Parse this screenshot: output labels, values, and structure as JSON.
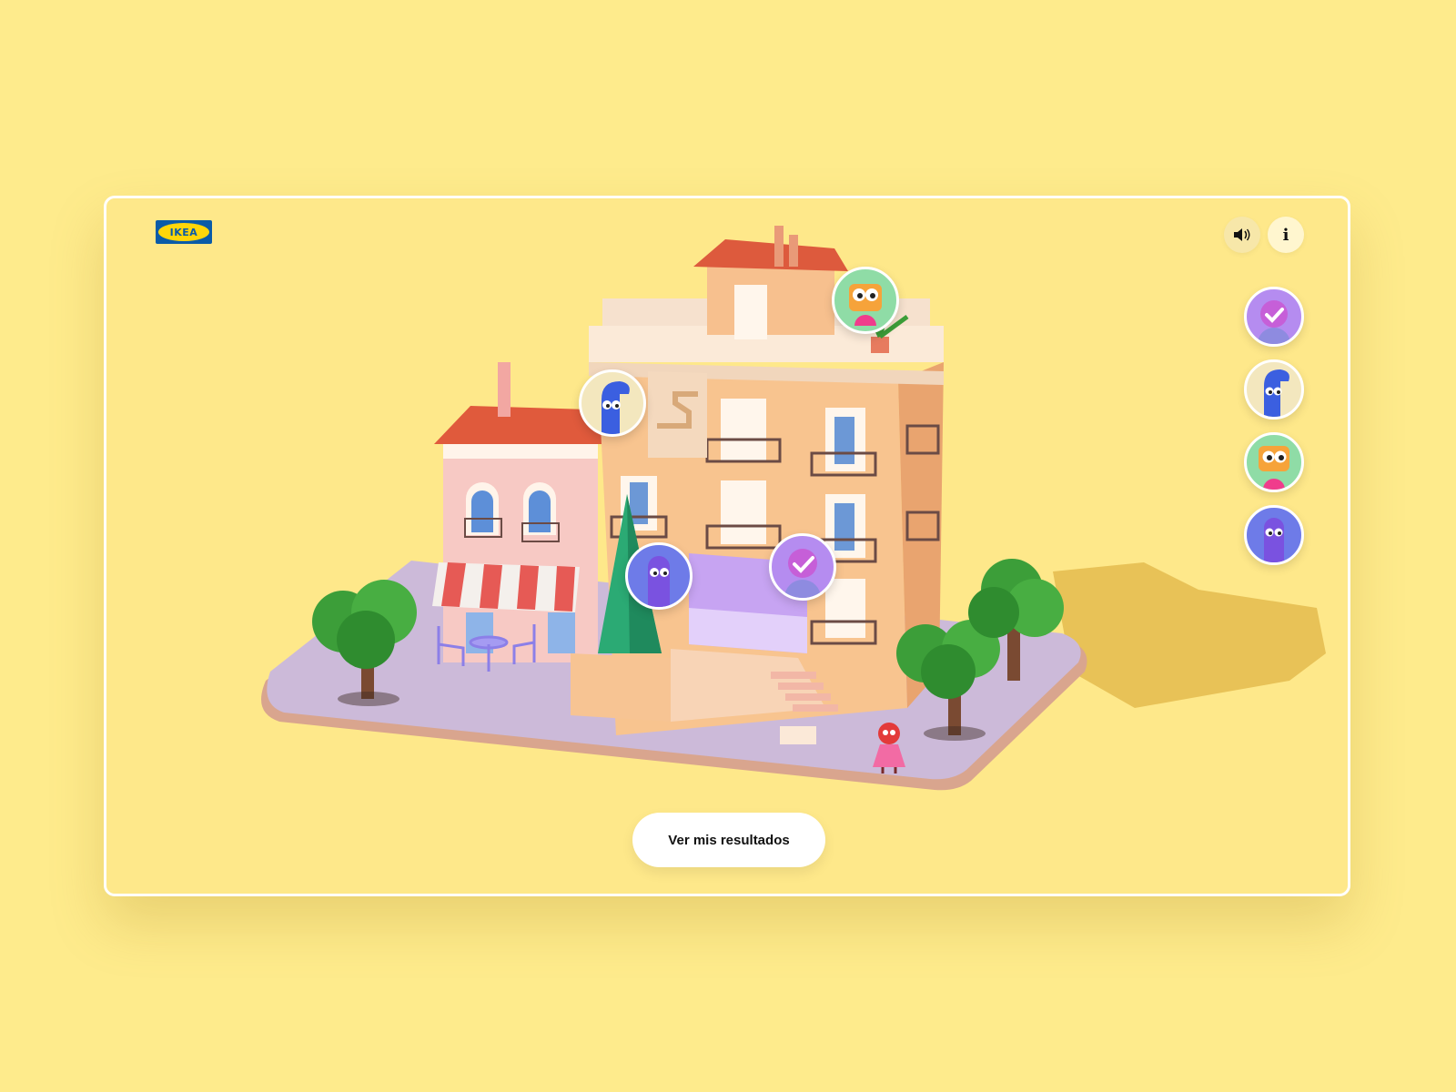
{
  "brand": {
    "logo_text": "IKEA"
  },
  "controls": {
    "sound_icon": "speaker-icon",
    "info_icon": "info-icon",
    "info_glyph": "i"
  },
  "avatars": [
    {
      "name": "purple-heart-check",
      "bg": "#B58CF0",
      "completed": true
    },
    {
      "name": "blue-bent-character",
      "bg": "#F3E7BE",
      "completed": false
    },
    {
      "name": "orange-square-character",
      "bg": "#8FDCA6",
      "completed": false
    },
    {
      "name": "purple-tall-character",
      "bg": "#6E7BE8",
      "completed": false
    }
  ],
  "cta": {
    "label": "Ver mis resultados"
  },
  "colors": {
    "background": "#FEEB8C",
    "building_main": "#F8C48F",
    "building_pink": "#F6C2C0",
    "roof": "#E0573A",
    "plaza": "#CBB9D9",
    "tree": "#3E9A3A"
  }
}
